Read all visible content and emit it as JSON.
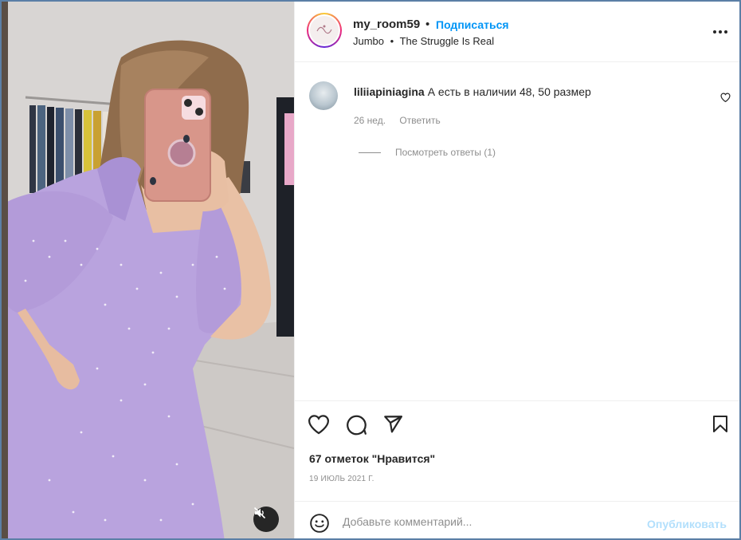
{
  "post": {
    "username": "my_room59",
    "separator": "•",
    "follow_label": "Подписаться",
    "audio_artist": "Jumbo",
    "audio_sep": "•",
    "audio_title": "The Struggle Is Real",
    "avatar_icon": "boutique-logo-icon"
  },
  "comment": {
    "username": "liliiapiniagina",
    "text": "А есть в наличии 48, 50 размер",
    "age": "26 нед.",
    "reply_label": "Ответить",
    "view_replies": "Посмотреть ответы (1)"
  },
  "actions": {
    "icons": [
      "heart-icon",
      "comment-icon",
      "share-icon",
      "bookmark-icon"
    ],
    "likes": "67 отметок \"Нравится\"",
    "date": "19 ИЮЛЬ 2021 Г."
  },
  "comment_box": {
    "placeholder": "Добавьте комментарий...",
    "publish_label": "Опубликовать"
  },
  "colors": {
    "accent": "#0095f6",
    "publish_disabled": "#b2dffc",
    "secondary_text": "#8e8e8e",
    "dress": "#b8a2dd",
    "frame_border": "#5b7fa6"
  }
}
